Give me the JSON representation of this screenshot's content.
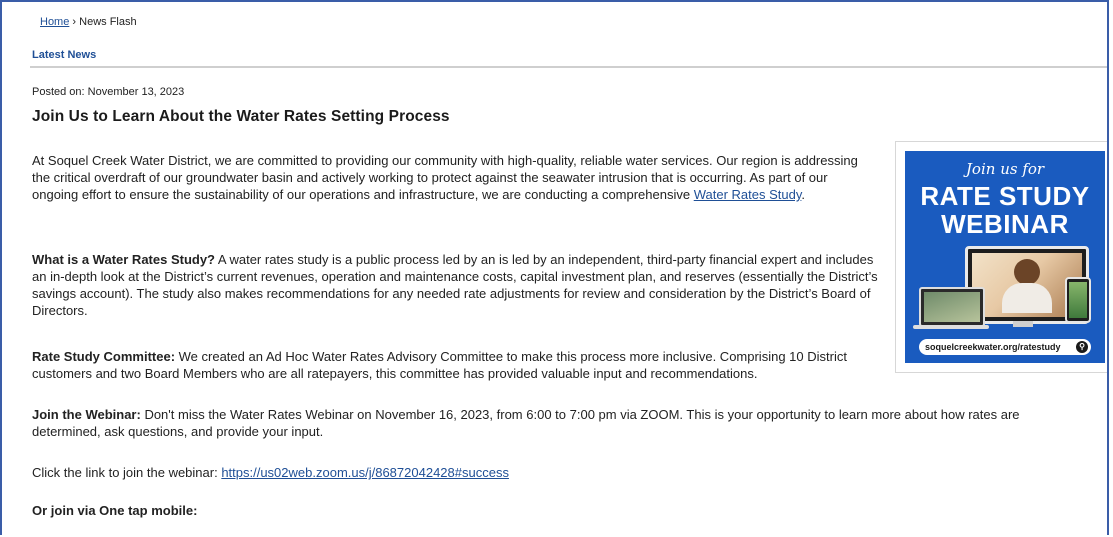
{
  "breadcrumb": {
    "home": "Home",
    "separator": "›",
    "current": "News Flash"
  },
  "section": {
    "title": "Latest News"
  },
  "article": {
    "posted": "Posted on: November 13, 2023",
    "title": "Join Us to Learn About the Water Rates Setting Process",
    "p1_text": "At Soquel Creek Water District, we are committed to providing our community with high-quality, reliable water services. Our region is addressing the critical overdraft of our groundwater basin and actively working to protect against the seawater intrusion that is occurring. As part of our ongoing effort to ensure the sustainability of our operations and infrastructure, we are conducting a comprehensive ",
    "p1_link": "Water Rates Study",
    "p1_end": ".",
    "p2_label": "What is a Water Rates Study?",
    "p2_text": " A water rates study is a public process led by an is led by an independent, third-party financial expert and includes an in-depth look at the District’s current revenues, operation and maintenance costs, capital investment plan, and reserves (essentially the District’s savings account). The study also makes recommendations for any needed rate adjustments for review and consideration by the District’s Board of Directors.",
    "p3_label": "Rate Study Committee:",
    "p3_text": " We created an Ad Hoc Water Rates Advisory Committee to make this process more inclusive. Comprising 10 District customers and two Board Members who are all ratepayers, this committee has provided valuable input and recommendations.",
    "p4_label": "Join the Webinar:",
    "p4_text": " Don't miss the Water Rates Webinar on November 16, 2023, from 6:00 to 7:00 pm via ZOOM. This is your opportunity to learn more about how rates are determined, ask questions, and provide your input.",
    "p5_text": "Click the link to join the webinar: ",
    "p5_link": "https://us02web.zoom.us/j/86872042428#success",
    "p6_text": "Or join via One tap mobile:"
  },
  "promo": {
    "join": "Join us for",
    "head1": "RATE STUDY",
    "head2": "WEBINAR",
    "url": "soquelcreekwater.org/ratestudy",
    "search_icon": "⚲",
    "bg_color": "#1a5bbf"
  },
  "colors": {
    "link": "#1f4f96",
    "frame_border": "#3a5da8"
  }
}
